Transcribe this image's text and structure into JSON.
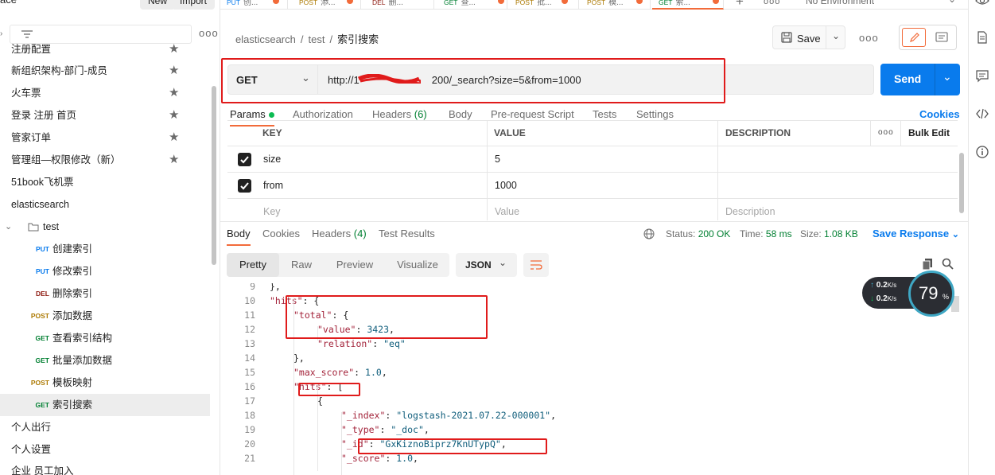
{
  "sidebar": {
    "workspace_label": "ace",
    "new_label": "New",
    "import_label": "Import",
    "more": "ooo",
    "items": [
      {
        "label": "注册配置",
        "star": "★"
      },
      {
        "label": "新组织架构-部门-成员",
        "star": "★"
      },
      {
        "label": "火车票",
        "star": "★"
      },
      {
        "label": "登录 注册 首页",
        "star": "★"
      },
      {
        "label": "管家订单",
        "star": "★"
      },
      {
        "label": "管理组—权限修改（新）",
        "star": "★"
      },
      {
        "label": "51book飞机票"
      },
      {
        "label": "elasticsearch"
      },
      {
        "label": "test"
      },
      {
        "method": "PUT",
        "label": "创建索引"
      },
      {
        "method": "PUT",
        "label": "修改索引"
      },
      {
        "method": "DEL",
        "label": "删除索引"
      },
      {
        "method": "POST",
        "label": "添加数据"
      },
      {
        "method": "GET",
        "label": "查看索引结构"
      },
      {
        "method": "GET",
        "label": "批量添加数据"
      },
      {
        "method": "POST",
        "label": "模板映射"
      },
      {
        "method": "GET",
        "label": "索引搜索"
      },
      {
        "label": "个人出行"
      },
      {
        "label": "个人设置"
      },
      {
        "label": "企业 员工加入"
      }
    ]
  },
  "tabs": [
    {
      "method": "PUT",
      "name": "创..."
    },
    {
      "method": "POST",
      "name": "添..."
    },
    {
      "method": "DEL",
      "name": "删..."
    },
    {
      "method": "GET",
      "name": "查..."
    },
    {
      "method": "POST",
      "name": "批..."
    },
    {
      "method": "POST",
      "name": "模..."
    },
    {
      "method": "GET",
      "name": "索..."
    }
  ],
  "tab_add": "+",
  "tab_more": "ooo",
  "environment": "No Environment",
  "breadcrumb": {
    "a": "elasticsearch",
    "sep": "/",
    "b": "test",
    "current": "索引搜索"
  },
  "save_label": "Save",
  "header_more": "ooo",
  "request": {
    "method": "GET",
    "url": "http://1       200/_search?size=5&from=1000",
    "send": "Send"
  },
  "request_tabs": {
    "params": "Params",
    "authorization": "Authorization",
    "headers": "Headers",
    "headers_count": "(6)",
    "body": "Body",
    "prerequest": "Pre-request Script",
    "tests": "Tests",
    "settings": "Settings",
    "cookies": "Cookies"
  },
  "params": {
    "headers": {
      "key": "KEY",
      "value": "VALUE",
      "description": "DESCRIPTION",
      "more": "ooo",
      "bulk_edit": "Bulk Edit"
    },
    "rows": [
      {
        "key": "size",
        "value": "5",
        "checked": true
      },
      {
        "key": "from",
        "value": "1000",
        "checked": true
      }
    ],
    "placeholders": {
      "key": "Key",
      "value": "Value",
      "description": "Description"
    }
  },
  "response": {
    "tabs": {
      "body": "Body",
      "cookies": "Cookies",
      "headers": "Headers",
      "headers_count": "(4)",
      "test_results": "Test Results"
    },
    "status_label": "Status:",
    "status_value": "200 OK",
    "time_label": "Time:",
    "time_value": "58 ms",
    "size_label": "Size:",
    "size_value": "1.08 KB",
    "save_response": "Save Response",
    "views": [
      "Pretty",
      "Raw",
      "Preview",
      "Visualize"
    ],
    "format": "JSON",
    "code_lines": [
      {
        "n": "9",
        "indent": 1,
        "parts": [
          [
            "p",
            "},"
          ]
        ]
      },
      {
        "n": "10",
        "indent": 1,
        "parts": [
          [
            "k",
            "\"hits\""
          ],
          [
            "p",
            ": {"
          ]
        ]
      },
      {
        "n": "11",
        "indent": 2,
        "parts": [
          [
            "k",
            "\"total\""
          ],
          [
            "p",
            ": {"
          ]
        ]
      },
      {
        "n": "12",
        "indent": 3,
        "parts": [
          [
            "k",
            "\"value\""
          ],
          [
            "p",
            ": "
          ],
          [
            "n",
            "3423"
          ],
          [
            "p",
            ","
          ]
        ]
      },
      {
        "n": "13",
        "indent": 3,
        "parts": [
          [
            "k",
            "\"relation\""
          ],
          [
            "p",
            ": "
          ],
          [
            "s",
            "\"eq\""
          ]
        ]
      },
      {
        "n": "14",
        "indent": 2,
        "parts": [
          [
            "p",
            "},"
          ]
        ]
      },
      {
        "n": "15",
        "indent": 2,
        "parts": [
          [
            "k",
            "\"max_score\""
          ],
          [
            "p",
            ": "
          ],
          [
            "n",
            "1.0"
          ],
          [
            "p",
            ","
          ]
        ]
      },
      {
        "n": "16",
        "indent": 2,
        "parts": [
          [
            "k",
            "\"hits\""
          ],
          [
            "p",
            ": ["
          ]
        ]
      },
      {
        "n": "17",
        "indent": 3,
        "parts": [
          [
            "p",
            "{"
          ]
        ]
      },
      {
        "n": "18",
        "indent": 4,
        "parts": [
          [
            "k",
            "\"_index\""
          ],
          [
            "p",
            ": "
          ],
          [
            "s",
            "\"logstash-2021.07.22-000001\""
          ],
          [
            "p",
            ","
          ]
        ]
      },
      {
        "n": "19",
        "indent": 4,
        "parts": [
          [
            "k",
            "\"_type\""
          ],
          [
            "p",
            ": "
          ],
          [
            "s",
            "\"_doc\""
          ],
          [
            "p",
            ","
          ]
        ]
      },
      {
        "n": "20",
        "indent": 4,
        "parts": [
          [
            "k",
            "\"_id\""
          ],
          [
            "p",
            ": "
          ],
          [
            "s",
            "\"GxKiznoBiprz7KnUTypQ\""
          ],
          [
            "p",
            ","
          ]
        ]
      },
      {
        "n": "21",
        "indent": 4,
        "parts": [
          [
            "k",
            "\"_score\""
          ],
          [
            "p",
            ": "
          ],
          [
            "n",
            "1.0"
          ],
          [
            "p",
            ","
          ]
        ]
      }
    ]
  },
  "net_widget": {
    "up": "0.2",
    "down": "0.2",
    "unit": "K/s",
    "gauge": "79",
    "gauge_unit": "%"
  },
  "colors": {
    "accent": "#f26b3a",
    "send": "#097bed",
    "annotation": "#e01b1b",
    "get": "#007f31",
    "post": "#ad7a03"
  }
}
